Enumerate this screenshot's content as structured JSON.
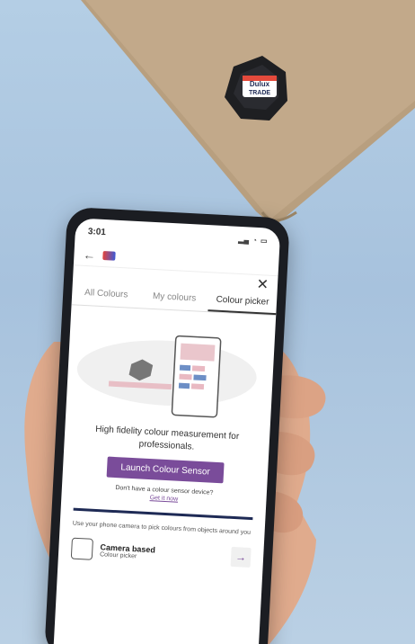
{
  "status": {
    "time": "3:01"
  },
  "tabs": [
    "All Colours",
    "My colours",
    "Colour picker"
  ],
  "headline": "High fidelity colour measurement for professionals.",
  "launch_button": "Launch Colour Sensor",
  "no_device": "Don't have a colour sensor device?",
  "get_link": "Get it now",
  "camera_desc": "Use your phone camera to pick colours from objects around you",
  "camera_title": "Camera based",
  "camera_sub": "Colour picker",
  "device_logo": {
    "line1": "Dulux",
    "line2": "TRADE"
  }
}
